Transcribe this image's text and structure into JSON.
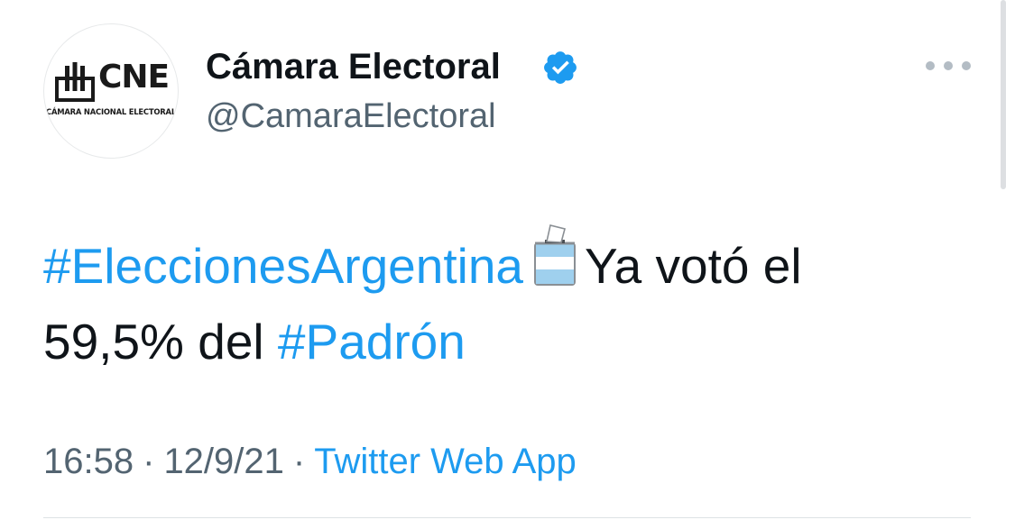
{
  "author": {
    "display_name": "Cámara Electoral",
    "handle": "@CamaraElectoral",
    "avatar": {
      "logo_text": "CNE",
      "logo_subtitle": "CÁMARA NACIONAL ELECTORAL"
    },
    "verified_icon": "verified-badge-icon"
  },
  "tweet": {
    "hashtag_1": "#EleccionesArgentina",
    "emoji": "ballot-box-icon",
    "text_1": "Ya votó el",
    "text_2": "59,5% del",
    "hashtag_2": "#Padrón"
  },
  "meta": {
    "time": "16:58",
    "separator": "·",
    "date": "12/9/21",
    "source": "Twitter Web App"
  },
  "colors": {
    "link": "#1d9bf0",
    "text": "#0f1419",
    "secondary": "#536471"
  }
}
